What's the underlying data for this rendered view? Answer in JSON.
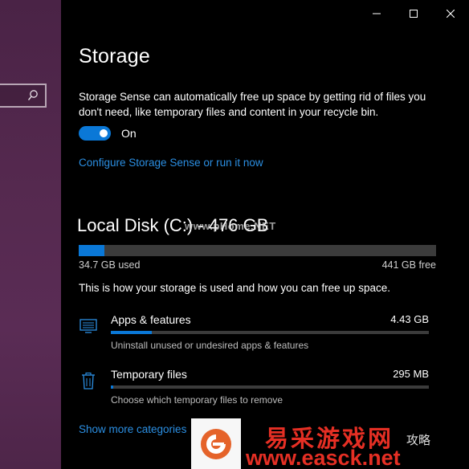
{
  "colors": {
    "accent": "#0a78d7",
    "link": "#2b8fe3",
    "background": "#000000",
    "left_pane": "#55294f",
    "watermark_red": "#e52f24"
  },
  "left_pane": {
    "search_icon": "search-icon"
  },
  "window": {
    "controls": [
      "minimize-icon",
      "maximize-icon",
      "close-icon"
    ]
  },
  "storage": {
    "title": "Storage",
    "description": "Storage Sense can automatically free up space by getting rid of files you don't need, like temporary files and content in your recycle bin.",
    "toggle_state": "On",
    "toggle_on": true,
    "configure_link": "Configure Storage Sense or run it now"
  },
  "disk": {
    "title": "Local Disk (C:) - 476 GB",
    "used_fraction": 0.073,
    "used_label": "34.7 GB used",
    "free_label": "441 GB free",
    "usage_description": "This is how your storage is used and how you can free up space."
  },
  "categories": [
    {
      "icon": "monitor-icon",
      "name": "Apps & features",
      "size": "4.43 GB",
      "fraction": 0.128,
      "subtitle": "Uninstall unused or undesired apps & features"
    },
    {
      "icon": "trash-icon",
      "name": "Temporary files",
      "size": "295 MB",
      "fraction": 0.007,
      "subtitle": "Choose which temporary files to remove"
    }
  ],
  "show_more_link": "Show more categories",
  "watermark": {
    "mid_text": "www.pHome.NET",
    "cn_text": "易采游戏网",
    "url_text": "www.easck.net",
    "small_text": "攻略"
  }
}
